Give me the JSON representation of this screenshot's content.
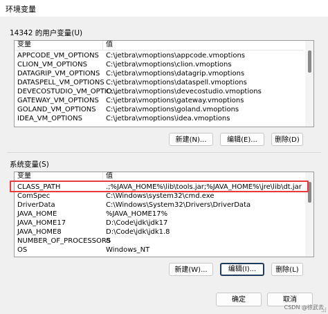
{
  "window": {
    "title": "环境变量"
  },
  "user_vars": {
    "label": "14342 的用户变量(U)",
    "col_name": "变量",
    "col_value": "值",
    "rows": [
      {
        "name": "APPCODE_VM_OPTIONS",
        "value": "C:\\jetbra\\vmoptions\\appcode.vmoptions"
      },
      {
        "name": "CLION_VM_OPTIONS",
        "value": "C:\\jetbra\\vmoptions\\clion.vmoptions"
      },
      {
        "name": "DATAGRIP_VM_OPTIONS",
        "value": "C:\\jetbra\\vmoptions\\datagrip.vmoptions"
      },
      {
        "name": "DATASPELL_VM_OPTIONS",
        "value": "C:\\jetbra\\vmoptions\\dataspell.vmoptions"
      },
      {
        "name": "DEVECOSTUDIO_VM_OPTIO...",
        "value": "C:\\jetbra\\vmoptions\\devecostudio.vmoptions"
      },
      {
        "name": "GATEWAY_VM_OPTIONS",
        "value": "C:\\jetbra\\vmoptions\\gateway.vmoptions"
      },
      {
        "name": "GOLAND_VM_OPTIONS",
        "value": "C:\\jetbra\\vmoptions\\goland.vmoptions"
      },
      {
        "name": "IDEA_VM_OPTIONS",
        "value": "C:\\jetbra\\vmoptions\\idea.vmoptions"
      }
    ],
    "buttons": {
      "new": "新建(N)...",
      "edit": "编辑(E)...",
      "delete": "删除(D)"
    }
  },
  "system_vars": {
    "label": "系统变量(S)",
    "col_name": "变量",
    "col_value": "值",
    "rows": [
      {
        "name": "CLASS_PATH",
        "value": ".;%JAVA_HOME%\\lib\\tools.jar;%JAVA_HOME%\\jre\\lib\\dt.jar"
      },
      {
        "name": "ComSpec",
        "value": "C:\\Windows\\system32\\cmd.exe"
      },
      {
        "name": "DriverData",
        "value": "C:\\Windows\\System32\\Drivers\\DriverData"
      },
      {
        "name": "JAVA_HOME",
        "value": "%JAVA_HOME17%"
      },
      {
        "name": "JAVA_HOME17",
        "value": "D:\\Code\\jdk\\jdk17"
      },
      {
        "name": "JAVA_HOME8",
        "value": "D:\\Code\\jdk\\jdk1.8"
      },
      {
        "name": "NUMBER_OF_PROCESSORS",
        "value": "8"
      },
      {
        "name": "OS",
        "value": "Windows_NT"
      }
    ],
    "buttons": {
      "new": "新建(W)...",
      "edit": "编辑(I)...",
      "delete": "删除(L)"
    }
  },
  "footer": {
    "ok": "确定",
    "cancel": "取消"
  },
  "watermark": "CSDN @徐武去"
}
